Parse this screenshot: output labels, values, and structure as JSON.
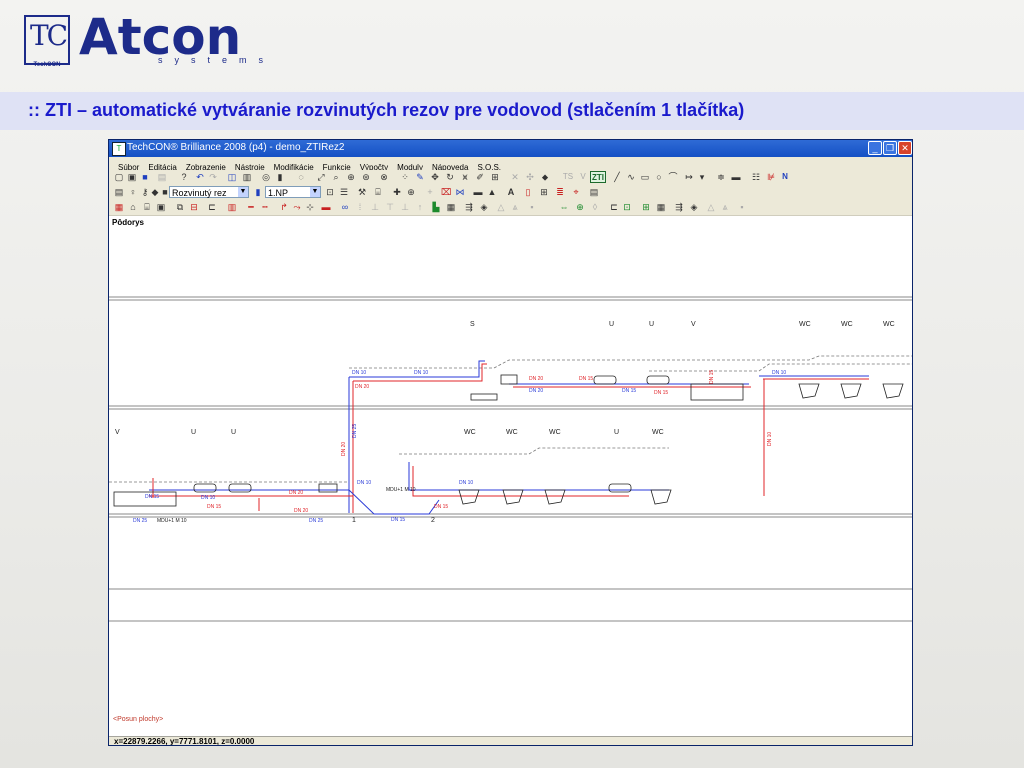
{
  "brand": {
    "mark": "TC",
    "mark_sub": "TechCON",
    "word": "Atcon",
    "tagline": "systems"
  },
  "slide_title": ":: ZTI – automatické vytváranie rozvinutých rezov pre vodovod (stlačením 1 tlačítka)",
  "window": {
    "title": "TechCON® Brilliance 2008  (p4) - demo_ZTIRez2",
    "controls": [
      "_",
      "❐",
      "✕"
    ]
  },
  "menu": [
    "Súbor",
    "Editácia",
    "Zobrazenie",
    "Nástroje",
    "Modifikácie",
    "Funkcie",
    "Výpočty",
    "Moduly",
    "Nápoveda",
    "S.O.S."
  ],
  "toolbar": {
    "view_combo": "Rozvinutý rez",
    "floor_combo": "1.NP",
    "zti_label": "ZTI",
    "ts_label": "TS",
    "v_label": "V",
    "n_label": "N"
  },
  "canvas": {
    "floorplan_label": "Pôdorys",
    "hint": "<Posun plochy>",
    "upper_symbols": [
      "S",
      "U",
      "U",
      "V",
      "WC",
      "WC",
      "WC"
    ],
    "lower_symbols": [
      "V",
      "U",
      "U",
      "WC",
      "WC",
      "WC",
      "U",
      "WC"
    ],
    "pipe_labels": {
      "dn10": "DN 10",
      "dn15": "DN 15",
      "dn20": "DN 20",
      "dn25": "DN 25"
    },
    "riser_labels": [
      "DN 20",
      "DN 25",
      "DN 10",
      "DN 15"
    ],
    "node_labels": [
      "1",
      "2"
    ],
    "meter_label": "MDU+1 M 10"
  },
  "status": {
    "coords": "x=22879.2266, y=7771.8101, z=0.0000"
  },
  "colors": {
    "title_text": "#1a1acc",
    "brand": "#1d2b8a",
    "cold_pipe": "#2a3ad8",
    "hot_pipe": "#e0242a"
  }
}
